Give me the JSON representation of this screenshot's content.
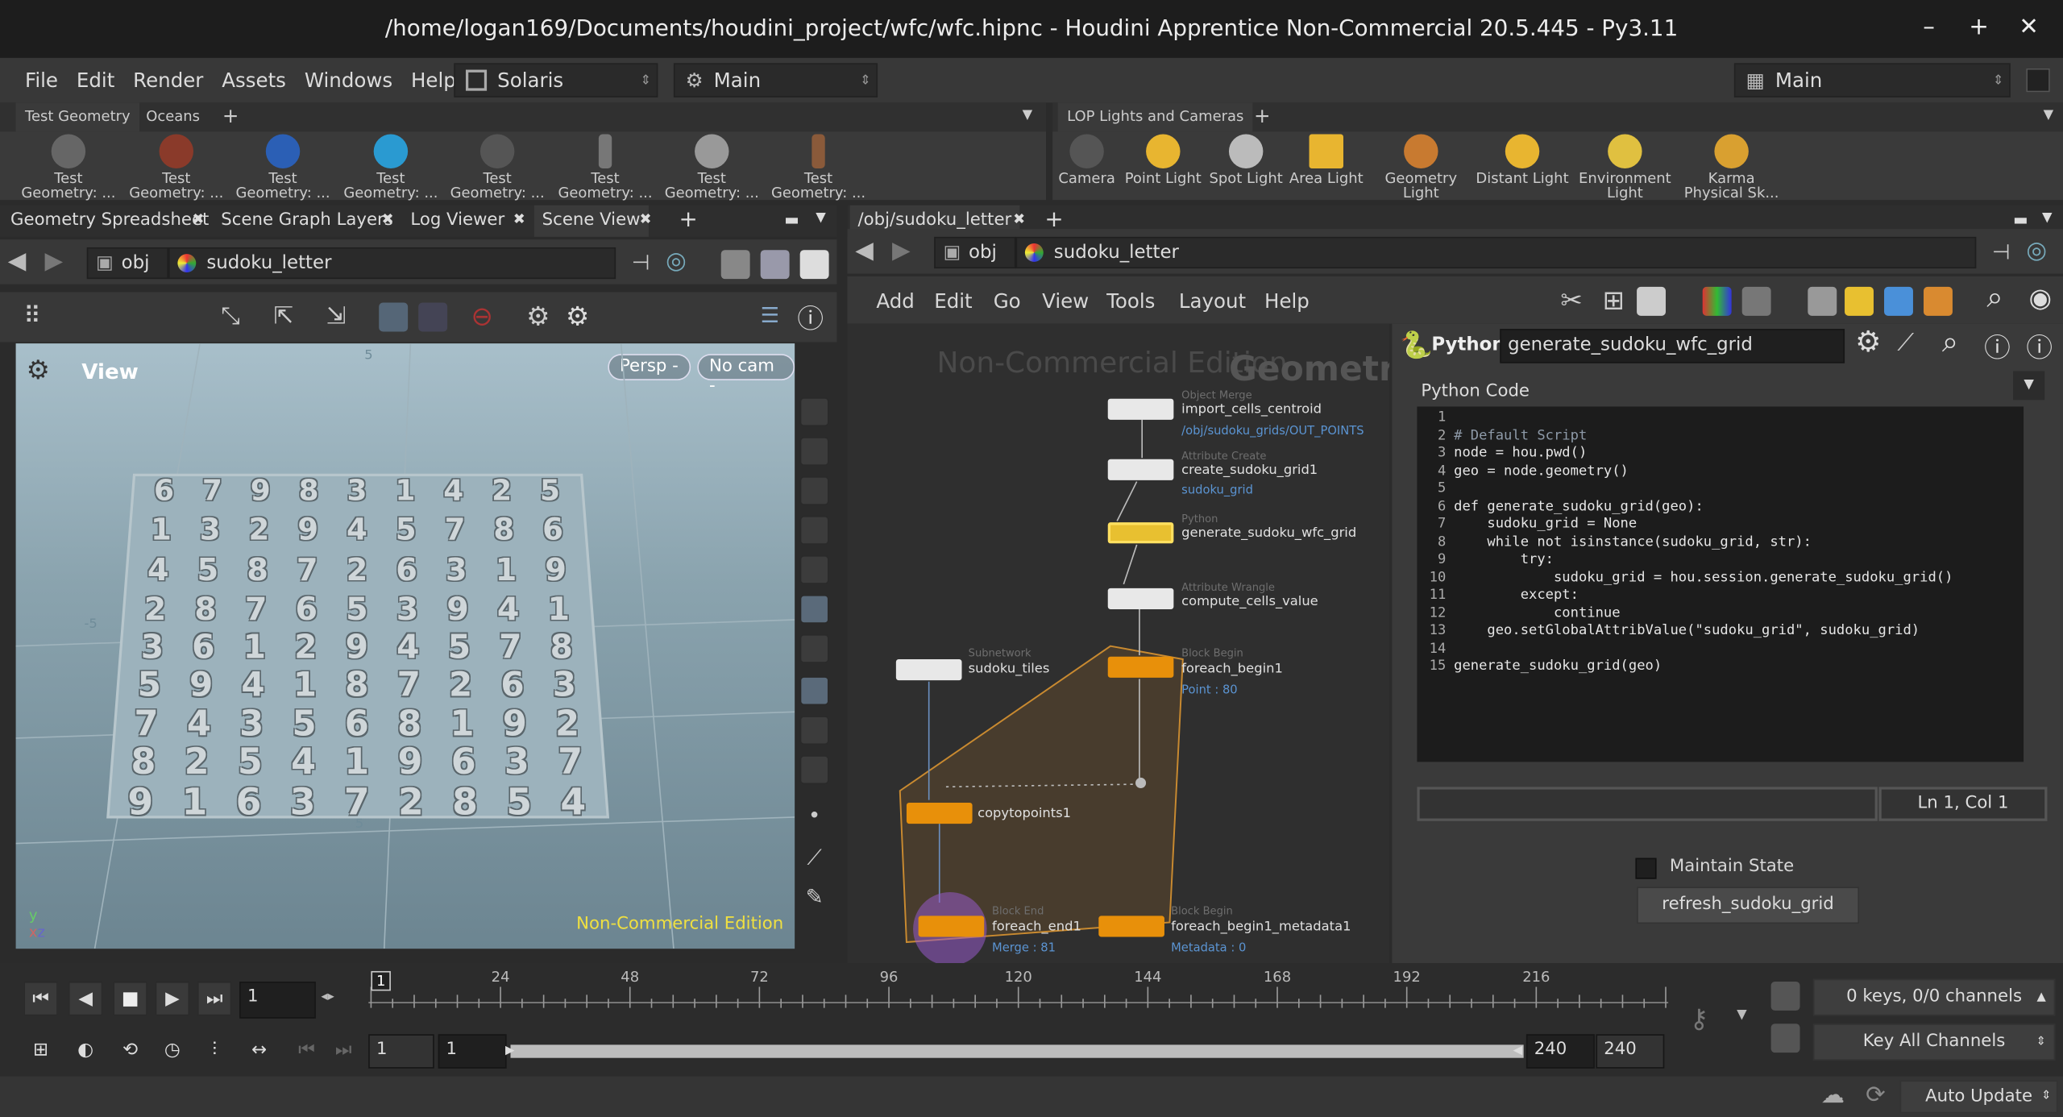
{
  "window": {
    "title": "/home/logan169/Documents/houdini_project/wfc/wfc.hipnc - Houdini Apprentice Non-Commercial 20.5.445 - Py3.11",
    "min": "–",
    "max": "+",
    "close": "✕"
  },
  "menu": [
    "File",
    "Edit",
    "Render",
    "Assets",
    "Windows",
    "Help"
  ],
  "desktop": "Solaris",
  "context": "Main",
  "right_desktop": "Main",
  "shelf_left": {
    "tabs": [
      "Test Geometry",
      "Oceans"
    ],
    "add": "+",
    "tools": [
      "Test Geometry: ...",
      "Test Geometry: ...",
      "Test Geometry: ...",
      "Test Geometry: ...",
      "Test Geometry: ...",
      "Test Geometry: ...",
      "Test Geometry: ...",
      "Test Geometry: ..."
    ]
  },
  "shelf_right": {
    "tabs": [
      "LOP Lights and Cameras"
    ],
    "add": "+",
    "tools": [
      "Camera",
      "Point Light",
      "Spot Light",
      "Area Light",
      "Geometry Light",
      "Distant Light",
      "Environment Light",
      "Karma Physical Sk..."
    ]
  },
  "left_pane": {
    "tabs": [
      "Geometry Spreadsheet",
      "Scene Graph Layers",
      "Log Viewer",
      "Scene View"
    ],
    "path_root": "obj",
    "path_node": "sudoku_letter",
    "view_label": "View",
    "persp": "Persp -",
    "cam": "No cam -",
    "watermark": "Non-Commercial Edition",
    "axis_labels": [
      "-5",
      "5",
      "5"
    ],
    "sudoku": [
      [
        6,
        7,
        9,
        8,
        3,
        1,
        4,
        2,
        5
      ],
      [
        1,
        3,
        2,
        9,
        4,
        5,
        7,
        8,
        6
      ],
      [
        4,
        5,
        8,
        7,
        2,
        6,
        3,
        1,
        9
      ],
      [
        2,
        8,
        7,
        6,
        5,
        3,
        9,
        4,
        1
      ],
      [
        3,
        6,
        1,
        2,
        9,
        4,
        5,
        7,
        8
      ],
      [
        5,
        9,
        4,
        1,
        8,
        7,
        2,
        6,
        3
      ],
      [
        7,
        4,
        3,
        5,
        6,
        8,
        1,
        9,
        2
      ],
      [
        8,
        2,
        5,
        4,
        1,
        9,
        6,
        3,
        7
      ],
      [
        9,
        1,
        6,
        3,
        7,
        2,
        8,
        5,
        4
      ]
    ]
  },
  "right_pane": {
    "tab": "/obj/sudoku_letter",
    "path_root": "obj",
    "path_node": "sudoku_letter",
    "menu": [
      "Add",
      "Edit",
      "Go",
      "View",
      "Tools",
      "Layout",
      "Help"
    ],
    "watermark_nc": "Non-Commercial Edition",
    "watermark_geo": "Geometry",
    "nodes": [
      {
        "type": "Object Merge",
        "name": "import_cells_centroid",
        "sub": "/obj/sudoku_grids/OUT_POINTS"
      },
      {
        "type": "Attribute Create",
        "name": "create_sudoku_grid1",
        "sub": "sudoku_grid"
      },
      {
        "type": "Python",
        "name": "generate_sudoku_wfc_grid",
        "sub": ""
      },
      {
        "type": "Attribute Wrangle",
        "name": "compute_cells_value",
        "sub": ""
      },
      {
        "type": "Block Begin",
        "name": "foreach_begin1",
        "sub": "Point : 80"
      },
      {
        "type": "Subnetwork",
        "name": "sudoku_tiles",
        "sub": ""
      },
      {
        "type": "",
        "name": "copytopoints1",
        "sub": ""
      },
      {
        "type": "Block End",
        "name": "foreach_end1",
        "sub": "Merge : 81"
      },
      {
        "type": "Block Begin",
        "name": "foreach_begin1_metadata1",
        "sub": "Metadata : 0"
      }
    ]
  },
  "params": {
    "node_type": "Python",
    "node_name": "generate_sudoku_wfc_grid",
    "section": "Python Code",
    "code": [
      "",
      "# Default Script",
      "node = hou.pwd()",
      "geo = node.geometry()",
      "",
      "def generate_sudoku_grid(geo):",
      "    sudoku_grid = None",
      "    while not isinstance(sudoku_grid, str):",
      "        try:",
      "            sudoku_grid = hou.session.generate_sudoku_grid()",
      "        except:",
      "            continue",
      "    geo.setGlobalAttribValue(\"sudoku_grid\", sudoku_grid)",
      "",
      "generate_sudoku_grid(geo)"
    ],
    "cursor": "Ln 1, Col 1",
    "maintain_state": "Maintain State",
    "refresh_button": "refresh_sudoku_grid"
  },
  "timeline": {
    "frame": "1",
    "ticks": [
      "24",
      "48",
      "72",
      "96",
      "120",
      "144",
      "168",
      "192",
      "216"
    ],
    "start": "1",
    "start2": "1",
    "end": "240",
    "end2": "240",
    "keys": "0 keys, 0/0 channels",
    "key_all": "Key All Channels",
    "marker": "1"
  },
  "status": {
    "auto_update": "Auto Update"
  }
}
